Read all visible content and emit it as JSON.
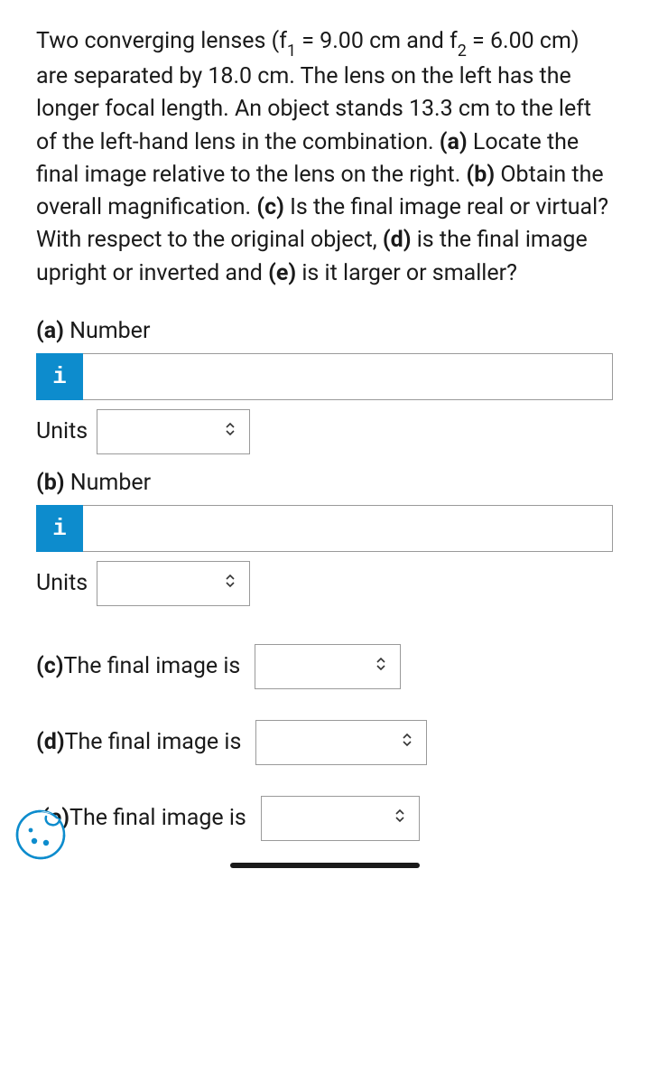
{
  "question": {
    "pre_f1": "Two converging lenses (f",
    "sub1": "1",
    "eq1": " = 9.00 cm and f",
    "sub2": "2",
    "post_f2": " = 6.00 cm) are separated by 18.0 cm. The lens on the left has the longer focal length. An object stands 13.3 cm to the left of the left-hand lens in the combination. ",
    "part_a_label": "(a)",
    "part_a_text": " Locate the final image relative to the lens on the right. ",
    "part_b_label": "(b)",
    "part_b_text": " Obtain the overall magnification. ",
    "part_c_label": "(c)",
    "part_c_text": " Is the final image real or virtual? With respect to the original object, ",
    "part_d_label": "(d)",
    "part_d_text": " is the final image upright or inverted and ",
    "part_e_label": "(e)",
    "part_e_text": " is it larger or smaller?"
  },
  "parts": {
    "a": {
      "label_bold": "(a)",
      "label_text": " Number",
      "info": "i",
      "value": "",
      "units_label": "Units",
      "units_value": ""
    },
    "b": {
      "label_bold": "(b)",
      "label_text": " Number",
      "info": "i",
      "value": "",
      "units_label": "Units",
      "units_value": ""
    },
    "c": {
      "label_bold": "(c)",
      "label_text": "The final image is",
      "value": ""
    },
    "d": {
      "label_bold": "(d)",
      "label_text": "The final image is",
      "value": ""
    },
    "e": {
      "label_bold": "(e)",
      "label_text": "The final image is",
      "value": ""
    }
  },
  "chevron": "⌃⌄"
}
